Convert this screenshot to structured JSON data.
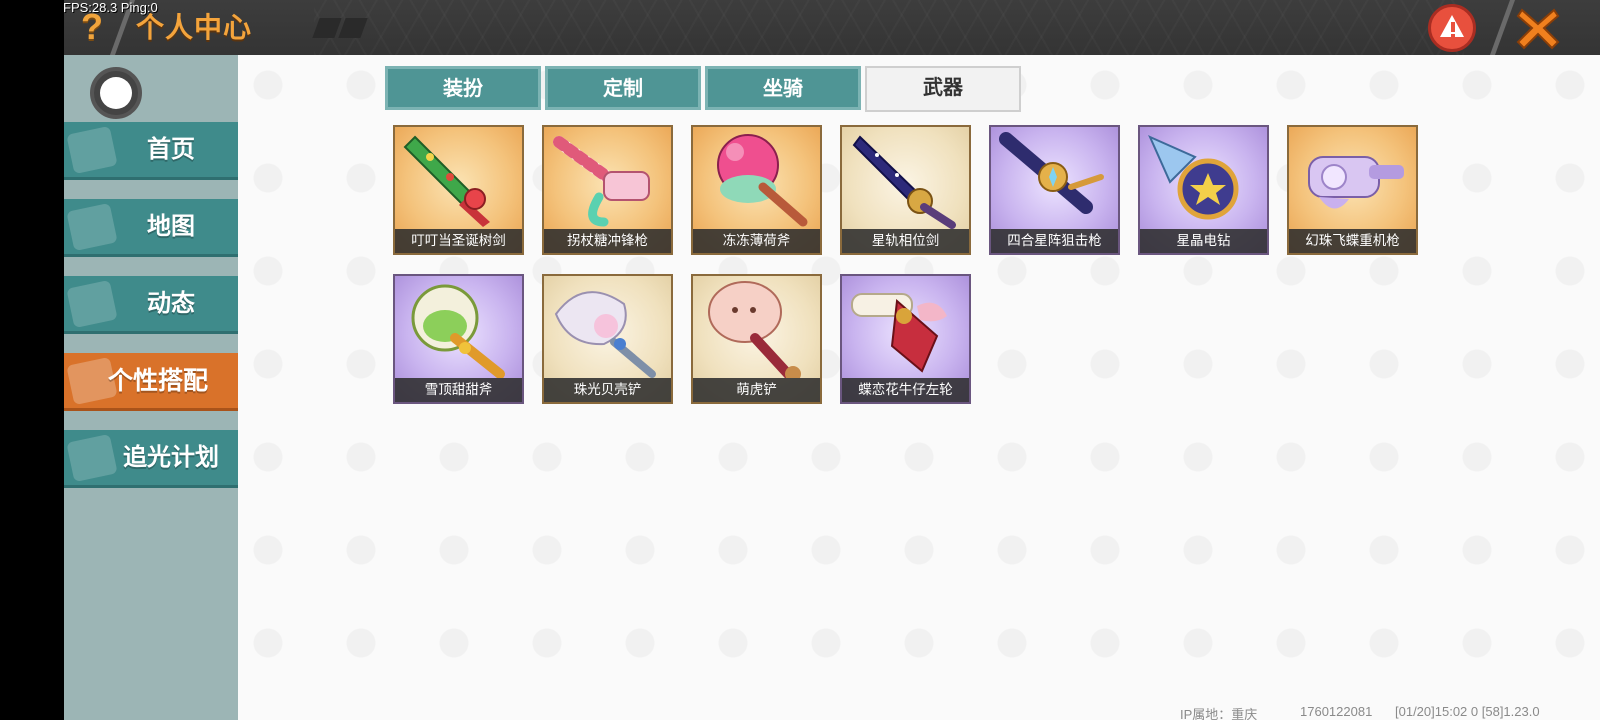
{
  "debug": {
    "fps_text": "FPS:28.3  Ping:0"
  },
  "header": {
    "title": "个人中心",
    "help_icon": "question-mark-icon",
    "warning_icon": "warning-icon",
    "close_icon": "close-x-icon"
  },
  "sidebar": {
    "items": [
      {
        "label": "首页",
        "icon": "home-icon",
        "active": false
      },
      {
        "label": "地图",
        "icon": "map-icon",
        "active": false
      },
      {
        "label": "动态",
        "icon": "bell-icon",
        "active": false
      },
      {
        "label": "个性搭配",
        "icon": "outfit-icon",
        "active": true
      },
      {
        "label": "追光计划",
        "icon": "plan-icon",
        "active": false
      }
    ]
  },
  "tabs": [
    {
      "label": "装扮",
      "active": false
    },
    {
      "label": "定制",
      "active": false
    },
    {
      "label": "坐骑",
      "active": false
    },
    {
      "label": "武器",
      "active": true
    }
  ],
  "weapons": [
    {
      "name": "叮叮当圣诞树剑",
      "rarity": "gold"
    },
    {
      "name": "拐杖糖冲锋枪",
      "rarity": "gold"
    },
    {
      "name": "冻冻薄荷斧",
      "rarity": "gold"
    },
    {
      "name": "星轨相位剑",
      "rarity": "cream"
    },
    {
      "name": "四合星阵狙击枪",
      "rarity": "purple"
    },
    {
      "name": "星晶电钻",
      "rarity": "purple"
    },
    {
      "name": "幻珠飞蝶重机枪",
      "rarity": "gold"
    },
    {
      "name": "雪顶甜甜斧",
      "rarity": "purple"
    },
    {
      "name": "珠光贝壳铲",
      "rarity": "cream"
    },
    {
      "name": "萌虎铲",
      "rarity": "cream"
    },
    {
      "name": "蝶恋花牛仔左轮",
      "rarity": "purple"
    }
  ],
  "footer": {
    "ip_location": "IP属地：重庆",
    "user_id": "1760122081",
    "build_info": "[01/20]15:02 0  [58]1.23.0"
  }
}
